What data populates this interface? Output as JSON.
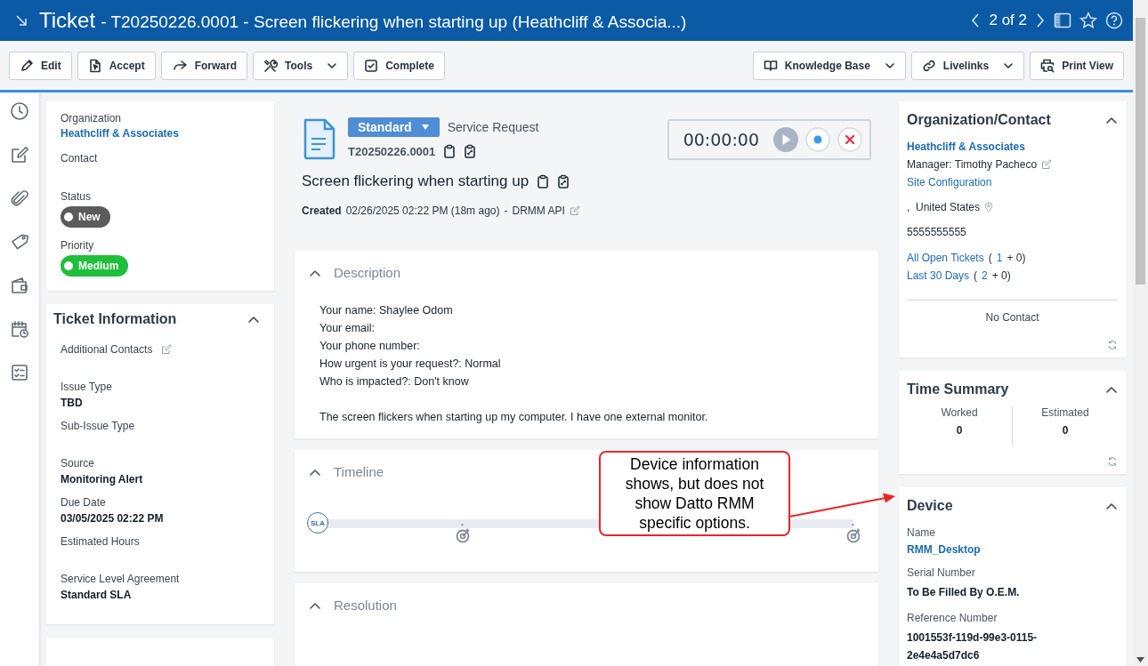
{
  "header": {
    "title": "Ticket",
    "subtitle": "- T20250226.0001 - Screen flickering when starting up (Heathcliff & Associa...)",
    "pager": "2 of 2"
  },
  "toolbar": {
    "left": [
      {
        "label": "Edit",
        "dropdown": false
      },
      {
        "label": "Accept",
        "dropdown": false
      },
      {
        "label": "Forward",
        "dropdown": false
      },
      {
        "label": "Tools",
        "dropdown": true
      },
      {
        "label": "Complete",
        "dropdown": false
      }
    ],
    "right": [
      {
        "label": "Knowledge Base",
        "dropdown": true
      },
      {
        "label": "Livelinks",
        "dropdown": true
      },
      {
        "label": "Print View",
        "dropdown": false
      }
    ]
  },
  "summary": [
    {
      "kind": "link",
      "label": "Organization",
      "value": "Heathcliff & Associates"
    },
    {
      "kind": "text",
      "label": "Contact"
    },
    {
      "kind": "pill",
      "label": "Status",
      "value": "New",
      "color": "#5c5c5c"
    },
    {
      "kind": "pill",
      "label": "Priority",
      "value": "Medium",
      "color": "#1fbf3b"
    }
  ],
  "ticket_information": {
    "title": "Ticket Information",
    "expanded": true,
    "fields": [
      {
        "label": "Additional Contacts",
        "editable": true
      },
      {
        "label": "Issue Type",
        "value": "TBD",
        "editable": false
      },
      {
        "label": "Sub-Issue Type",
        "editable": false
      },
      {
        "label": "Source",
        "value": "Monitoring Alert",
        "editable": false
      },
      {
        "label": "Due Date",
        "value": "03/05/2025 02:22 PM",
        "editable": false
      },
      {
        "label": "Estimated Hours",
        "editable": false
      },
      {
        "label": "Service Level Agreement",
        "value": "Standard SLA",
        "editable": false
      }
    ]
  },
  "ticket": {
    "type": "Standard",
    "category": "Service Request",
    "number": "T20250226.0001",
    "title": "Screen flickering when starting up",
    "created_label": "Created",
    "created": "02/26/2025 02:22 PM (18m ago)",
    "separator": "-",
    "source": "DRMM API",
    "timer": "00:00:00"
  },
  "sections": [
    {
      "kind": "description",
      "title": "Description",
      "expanded": true,
      "paragraphs": [
        [
          "Your name: Shaylee Odom",
          "Your email:",
          "Your phone number:",
          "How urgent is your request?: Normal",
          "Who is impacted?: Don't know"
        ],
        [
          "The screen flickers when starting up my computer. I have one external monitor."
        ]
      ]
    },
    {
      "kind": "timeline",
      "title": "Timeline",
      "expanded": true,
      "marker": "SLA"
    },
    {
      "kind": "resolution",
      "title": "Resolution",
      "expanded": true
    }
  ],
  "organization_contact": {
    "title": "Organization/Contact",
    "expanded": true,
    "organization": "Heathcliff & Associates",
    "manager": "Manager: Timothy Pacheco",
    "site": "Site Configuration",
    "address": ",  United States",
    "phone": "5555555555",
    "stats": [
      {
        "link": "All Open Tickets",
        "open": "(",
        "count": "1",
        "rest": "+ 0)"
      },
      {
        "link": "Last 30 Days",
        "open": "(",
        "count": "2",
        "rest": "+ 0)"
      }
    ],
    "contact": "No Contact"
  },
  "time_summary": {
    "title": "Time Summary",
    "expanded": true,
    "items": [
      {
        "label": "Worked",
        "value": "0"
      },
      {
        "label": "Estimated",
        "value": "0"
      }
    ]
  },
  "device": {
    "title": "Device",
    "expanded": true,
    "fields": [
      {
        "kind": "link",
        "label": "Name",
        "value": "RMM_Desktop"
      },
      {
        "kind": "text",
        "label": "Serial Number",
        "value": "To Be Filled By O.E.M."
      },
      {
        "kind": "text",
        "label": "Reference Number",
        "value": "1001553f-119d-99e3-0115-2e4e4a5d7dc6"
      }
    ]
  },
  "annotation": {
    "text": "Device information shows, but does not show Datto RMM specific options."
  }
}
